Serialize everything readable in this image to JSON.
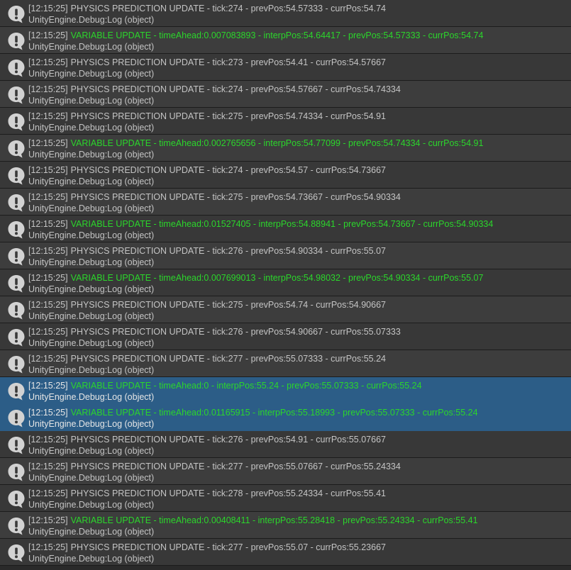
{
  "colors": {
    "row_even": "#383838",
    "row_odd": "#3d3d3d",
    "row_selected": "#2c5d87",
    "text_gray": "#c4c4c4",
    "text_green": "#2bd62b",
    "icon_fill": "#d2d2d2"
  },
  "icon_name": "info-message-icon",
  "entries": [
    {
      "time": "[12:15:25]",
      "message": "PHYSICS PREDICTION UPDATE - tick:274 - prevPos:54.57333 - currPos:54.74",
      "kind": "physics",
      "source": "UnityEngine.Debug:Log (object)",
      "selected": false
    },
    {
      "time": "[12:15:25]",
      "message": "VARIABLE UPDATE - timeAhead:0.007083893 - interpPos:54.64417 - prevPos:54.57333 - currPos:54.74",
      "kind": "variable",
      "source": "UnityEngine.Debug:Log (object)",
      "selected": false
    },
    {
      "time": "[12:15:25]",
      "message": "PHYSICS PREDICTION UPDATE - tick:273 - prevPos:54.41 - currPos:54.57667",
      "kind": "physics",
      "source": "UnityEngine.Debug:Log (object)",
      "selected": false
    },
    {
      "time": "[12:15:25]",
      "message": "PHYSICS PREDICTION UPDATE - tick:274 - prevPos:54.57667 - currPos:54.74334",
      "kind": "physics",
      "source": "UnityEngine.Debug:Log (object)",
      "selected": false
    },
    {
      "time": "[12:15:25]",
      "message": "PHYSICS PREDICTION UPDATE - tick:275 - prevPos:54.74334 - currPos:54.91",
      "kind": "physics",
      "source": "UnityEngine.Debug:Log (object)",
      "selected": false
    },
    {
      "time": "[12:15:25]",
      "message": "VARIABLE UPDATE - timeAhead:0.002765656 - interpPos:54.77099 - prevPos:54.74334 - currPos:54.91",
      "kind": "variable",
      "source": "UnityEngine.Debug:Log (object)",
      "selected": false
    },
    {
      "time": "[12:15:25]",
      "message": "PHYSICS PREDICTION UPDATE - tick:274 - prevPos:54.57 - currPos:54.73667",
      "kind": "physics",
      "source": "UnityEngine.Debug:Log (object)",
      "selected": false
    },
    {
      "time": "[12:15:25]",
      "message": "PHYSICS PREDICTION UPDATE - tick:275 - prevPos:54.73667 - currPos:54.90334",
      "kind": "physics",
      "source": "UnityEngine.Debug:Log (object)",
      "selected": false
    },
    {
      "time": "[12:15:25]",
      "message": "VARIABLE UPDATE - timeAhead:0.01527405 - interpPos:54.88941 - prevPos:54.73667 - currPos:54.90334",
      "kind": "variable",
      "source": "UnityEngine.Debug:Log (object)",
      "selected": false
    },
    {
      "time": "[12:15:25]",
      "message": "PHYSICS PREDICTION UPDATE - tick:276 - prevPos:54.90334 - currPos:55.07",
      "kind": "physics",
      "source": "UnityEngine.Debug:Log (object)",
      "selected": false
    },
    {
      "time": "[12:15:25]",
      "message": "VARIABLE UPDATE - timeAhead:0.007699013 - interpPos:54.98032 - prevPos:54.90334 - currPos:55.07",
      "kind": "variable",
      "source": "UnityEngine.Debug:Log (object)",
      "selected": false
    },
    {
      "time": "[12:15:25]",
      "message": "PHYSICS PREDICTION UPDATE - tick:275 - prevPos:54.74 - currPos:54.90667",
      "kind": "physics",
      "source": "UnityEngine.Debug:Log (object)",
      "selected": false
    },
    {
      "time": "[12:15:25]",
      "message": "PHYSICS PREDICTION UPDATE - tick:276 - prevPos:54.90667 - currPos:55.07333",
      "kind": "physics",
      "source": "UnityEngine.Debug:Log (object)",
      "selected": false
    },
    {
      "time": "[12:15:25]",
      "message": "PHYSICS PREDICTION UPDATE - tick:277 - prevPos:55.07333 - currPos:55.24",
      "kind": "physics",
      "source": "UnityEngine.Debug:Log (object)",
      "selected": false
    },
    {
      "time": "[12:15:25]",
      "message": "VARIABLE UPDATE - timeAhead:0 - interpPos:55.24 - prevPos:55.07333 - currPos:55.24",
      "kind": "variable",
      "source": "UnityEngine.Debug:Log (object)",
      "selected": true
    },
    {
      "time": "[12:15:25]",
      "message": "VARIABLE UPDATE - timeAhead:0.01165915 - interpPos:55.18993 - prevPos:55.07333 - currPos:55.24",
      "kind": "variable",
      "source": "UnityEngine.Debug:Log (object)",
      "selected": true
    },
    {
      "time": "[12:15:25]",
      "message": "PHYSICS PREDICTION UPDATE - tick:276 - prevPos:54.91 - currPos:55.07667",
      "kind": "physics",
      "source": "UnityEngine.Debug:Log (object)",
      "selected": false
    },
    {
      "time": "[12:15:25]",
      "message": "PHYSICS PREDICTION UPDATE - tick:277 - prevPos:55.07667 - currPos:55.24334",
      "kind": "physics",
      "source": "UnityEngine.Debug:Log (object)",
      "selected": false
    },
    {
      "time": "[12:15:25]",
      "message": "PHYSICS PREDICTION UPDATE - tick:278 - prevPos:55.24334 - currPos:55.41",
      "kind": "physics",
      "source": "UnityEngine.Debug:Log (object)",
      "selected": false
    },
    {
      "time": "[12:15:25]",
      "message": "VARIABLE UPDATE - timeAhead:0.00408411 - interpPos:55.28418 - prevPos:55.24334 - currPos:55.41",
      "kind": "variable",
      "source": "UnityEngine.Debug:Log (object)",
      "selected": false
    },
    {
      "time": "[12:15:25]",
      "message": "PHYSICS PREDICTION UPDATE - tick:277 - prevPos:55.07 - currPos:55.23667",
      "kind": "physics",
      "source": "UnityEngine.Debug:Log (object)",
      "selected": false
    }
  ]
}
